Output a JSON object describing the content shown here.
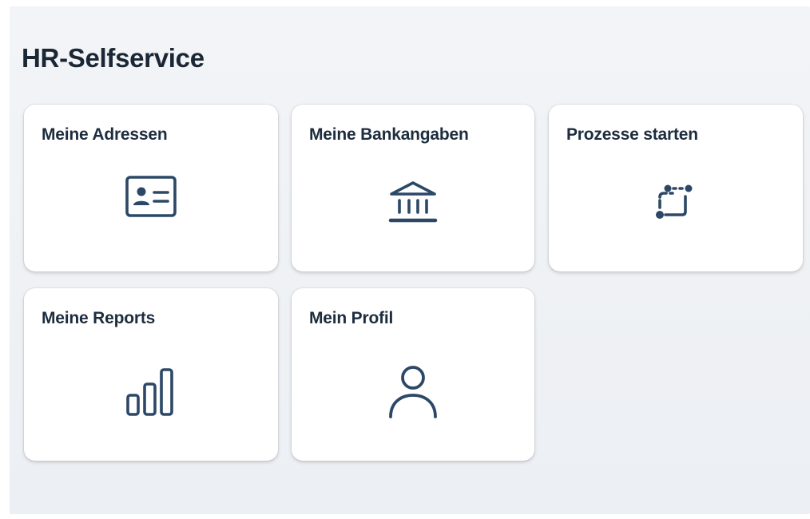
{
  "header": {
    "title": "HR-Selfservice"
  },
  "tiles": [
    {
      "title": "Meine Adressen",
      "icon": "address-card-icon"
    },
    {
      "title": "Meine Bankangaben",
      "icon": "bank-icon"
    },
    {
      "title": "Prozesse starten",
      "icon": "process-flow-icon"
    },
    {
      "title": "Meine Reports",
      "icon": "bar-chart-icon"
    },
    {
      "title": "Mein Profil",
      "icon": "user-profile-icon"
    }
  ],
  "colors": {
    "icon": "#2c4866",
    "title": "#1b2735",
    "background": "#eef1f5",
    "tile": "#ffffff"
  }
}
